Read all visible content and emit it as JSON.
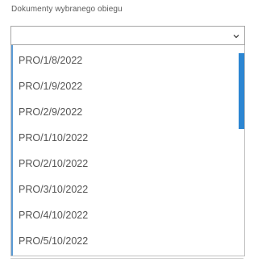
{
  "field": {
    "label": "Dokumenty wybranego obiegu",
    "selected_value": ""
  },
  "dropdown": {
    "options": [
      "PRO/1/8/2022",
      "PRO/1/9/2022",
      "PRO/2/9/2022",
      "PRO/1/10/2022",
      "PRO/2/10/2022",
      "PRO/3/10/2022",
      "PRO/4/10/2022",
      "PRO/5/10/2022"
    ]
  },
  "colors": {
    "accent": "#2c86d2",
    "text": "#555555",
    "border": "#a6a6a6"
  },
  "icons": {
    "select_chevron": "chevron-down-icon"
  }
}
